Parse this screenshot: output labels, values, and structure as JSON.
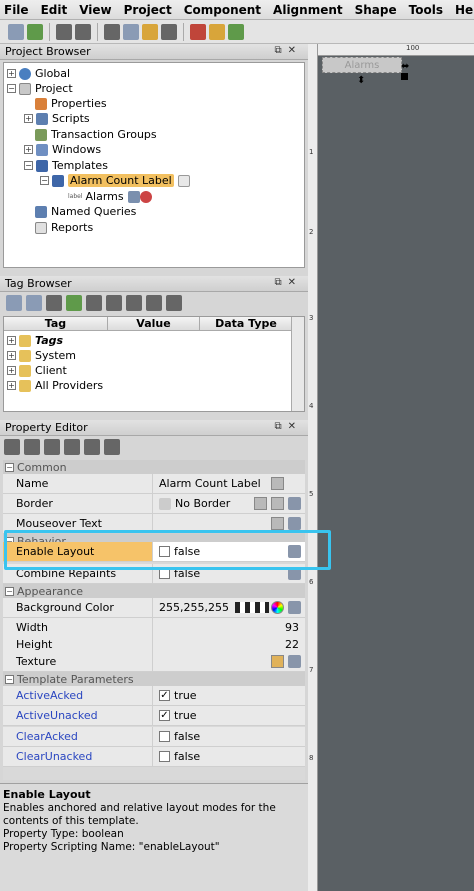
{
  "menu": [
    "File",
    "Edit",
    "View",
    "Project",
    "Component",
    "Alignment",
    "Shape",
    "Tools",
    "Help"
  ],
  "project_browser": {
    "title": "Project Browser",
    "items": [
      {
        "label": "Global"
      },
      {
        "label": "Project"
      },
      {
        "label": "Properties"
      },
      {
        "label": "Scripts"
      },
      {
        "label": "Transaction Groups"
      },
      {
        "label": "Windows"
      },
      {
        "label": "Templates"
      },
      {
        "label": "Alarm Count Label"
      },
      {
        "label": "Alarms",
        "prefix": "label"
      },
      {
        "label": "Named Queries"
      },
      {
        "label": "Reports"
      }
    ]
  },
  "tag_browser": {
    "title": "Tag Browser",
    "columns": [
      "Tag",
      "Value",
      "Data Type"
    ],
    "items": [
      "Tags",
      "System",
      "Client",
      "All Providers"
    ]
  },
  "property_editor": {
    "title": "Property Editor",
    "categories": {
      "common": "Common",
      "behavior": "Behavior",
      "appearance": "Appearance",
      "template_params": "Template Parameters"
    },
    "rows": {
      "name": {
        "label": "Name",
        "value": "Alarm Count Label"
      },
      "border": {
        "label": "Border",
        "value": "No Border"
      },
      "mouseover": {
        "label": "Mouseover Text",
        "value": ""
      },
      "enable_layout": {
        "label": "Enable Layout",
        "value": "false"
      },
      "combine_repaints": {
        "label": "Combine Repaints",
        "value": "false"
      },
      "background": {
        "label": "Background Color",
        "value": "255,255,255"
      },
      "width": {
        "label": "Width",
        "value": "93"
      },
      "height": {
        "label": "Height",
        "value": "22"
      },
      "texture": {
        "label": "Texture",
        "value": ""
      },
      "active_acked": {
        "label": "ActiveAcked",
        "value": "true"
      },
      "active_unacked": {
        "label": "ActiveUnacked",
        "value": "true"
      },
      "clear_acked": {
        "label": "ClearAcked",
        "value": "false"
      },
      "clear_unacked": {
        "label": "ClearUnacked",
        "value": "false"
      }
    },
    "description": {
      "title": "Enable Layout",
      "text": "Enables anchored and relative layout modes for the contents of this template.",
      "type": "Property Type: boolean",
      "scripting": "Property Scripting Name: \"enableLayout\""
    }
  },
  "canvas": {
    "ruler_top": "100",
    "ruler_left": [
      "1",
      "2",
      "3",
      "4",
      "5",
      "6",
      "7",
      "8"
    ],
    "label_text": "Alarms"
  },
  "colors": {
    "highlight": "#39c4ef",
    "selection": "#f2c060",
    "param_text": "#2a46c0"
  }
}
